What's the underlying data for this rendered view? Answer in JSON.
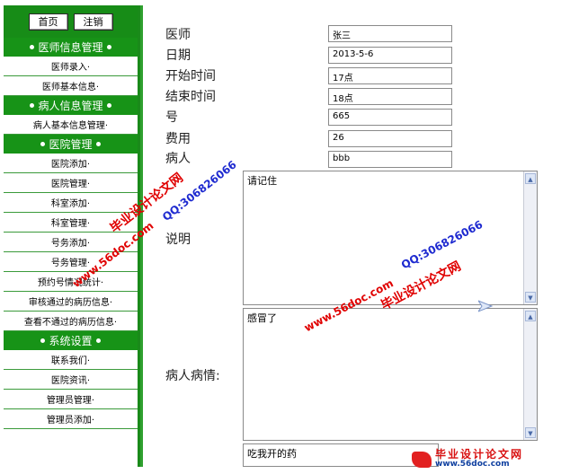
{
  "topbar": {
    "home_label": "首页",
    "logout_label": "注销"
  },
  "sections": [
    {
      "title": "医师信息管理",
      "items": [
        "医师录入·",
        "医师基本信息·"
      ]
    },
    {
      "title": "病人信息管理",
      "items": [
        "病人基本信息管理·"
      ]
    },
    {
      "title": "医院管理",
      "items": [
        "医院添加·",
        "医院管理·",
        "科室添加·",
        "科室管理·",
        "号务添加·",
        "号务管理·",
        "预约号情况统计·",
        "审核通过的病历信息·",
        "查看不通过的病历信息·"
      ]
    },
    {
      "title": "系统设置",
      "items": [
        "联系我们·",
        "医院资讯·",
        "管理员管理·",
        "管理员添加·"
      ]
    }
  ],
  "form": {
    "doctor_label": "医师",
    "doctor_value": "张三",
    "date_label": "日期",
    "date_value": "2013-5-6",
    "start_label": "开始时间",
    "start_value": "17点",
    "end_label": "结束时间",
    "end_value": "18点",
    "number_label": "号",
    "number_value": "665",
    "fee_label": "费用",
    "fee_value": "26",
    "patient_label": "病人",
    "patient_value": "bbb",
    "note_label": "说明",
    "note_value": "请记住",
    "condition_label": "病人病情:",
    "condition_value": "感冒了",
    "extra_value": "吃我开的药"
  },
  "watermarks": {
    "site_cn": "毕业设计论文网",
    "site_url": "www.56doc.com",
    "qq": "QQ:306826066"
  },
  "logo": {
    "cn": "毕业设计论文网",
    "url": "www.56doc.com"
  }
}
